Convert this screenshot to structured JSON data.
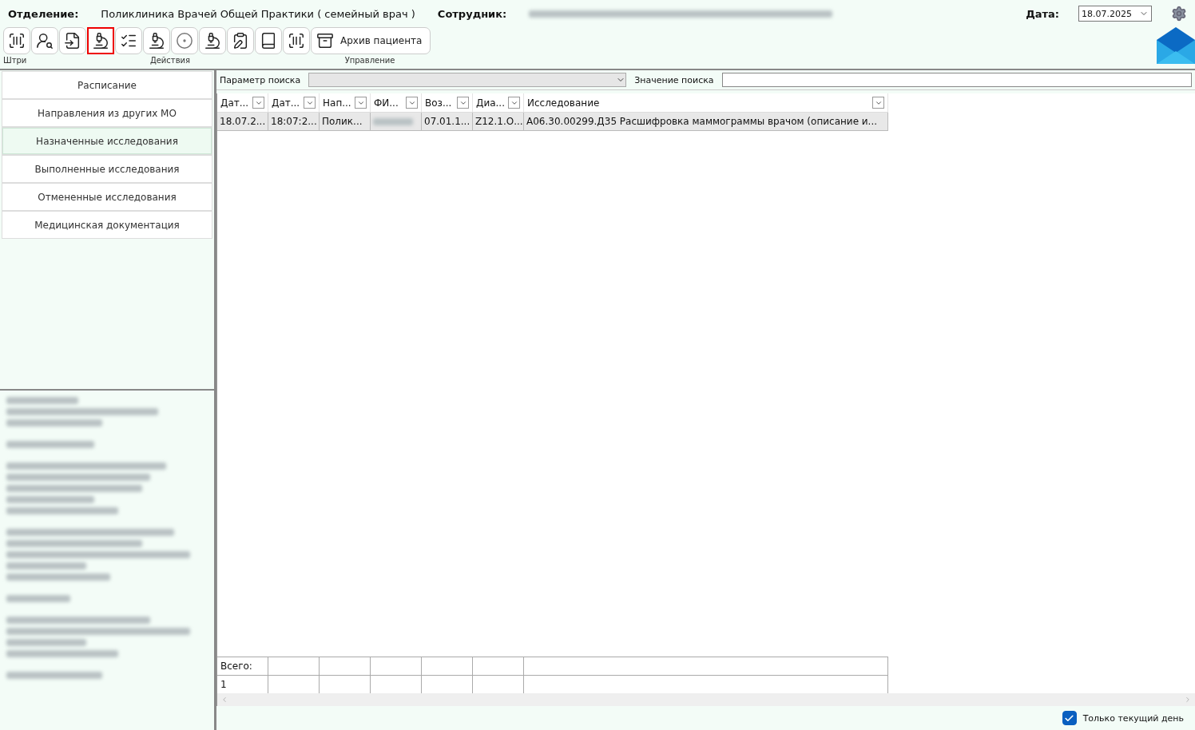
{
  "header": {
    "department_label": "Отделение:",
    "department": "Поликлиника Врачей Общей Практики ( семейный врач )",
    "employee_label": "Сотрудник:",
    "date_label": "Дата:",
    "date": "18.07.2025"
  },
  "toolbar": {
    "buttons": [
      {
        "kind": "barcode",
        "selected": false
      },
      {
        "kind": "user-back",
        "selected": false
      },
      {
        "kind": "doc-in",
        "selected": false
      },
      {
        "kind": "scope-check",
        "selected": true
      },
      {
        "kind": "list-check",
        "selected": false
      },
      {
        "kind": "scope-gear",
        "selected": false
      },
      {
        "kind": "disc",
        "selected": false
      },
      {
        "kind": "scope-x",
        "selected": false
      },
      {
        "kind": "clipboard",
        "selected": false
      },
      {
        "kind": "book",
        "selected": false
      },
      {
        "kind": "barcode",
        "selected": false
      }
    ],
    "archive_button": "Архив пациента",
    "groups": [
      "Штри",
      "Действия",
      "Управление"
    ]
  },
  "sidebar": {
    "items": [
      {
        "label": "Расписание",
        "selected": false
      },
      {
        "label": "Направления из других МО",
        "selected": false
      },
      {
        "label": "Назначенные исследования",
        "selected": true
      },
      {
        "label": "Выполненные исследования",
        "selected": false
      },
      {
        "label": "Отмененные исследования",
        "selected": false
      },
      {
        "label": "Медицинская документация",
        "selected": false
      }
    ]
  },
  "search": {
    "param_label": "Параметр поиска",
    "value_label": "Значение поиска"
  },
  "table": {
    "columns": [
      "Дат...",
      "Дат...",
      "Нап...",
      "ФИ...",
      "Воз...",
      "Диа...",
      "Исследование"
    ],
    "rows": [
      [
        "18.07.2...",
        "18:07:2...",
        "Полик...",
        "",
        "07.01.1...",
        "Z12.1.О...",
        "А06.30.00299.Д35  Расшифровка  маммограммы  врачом  (описание  и..."
      ]
    ],
    "footer": {
      "label": "Всего:",
      "count": "1"
    }
  },
  "only_today": {
    "label": "Только текущий день",
    "checked": true
  }
}
